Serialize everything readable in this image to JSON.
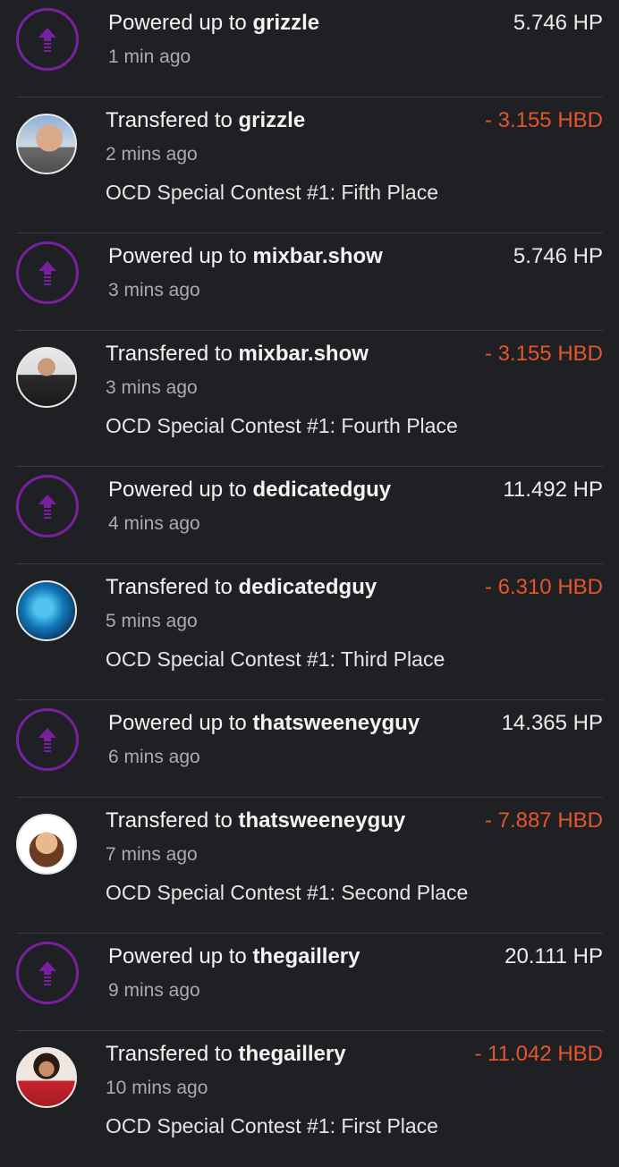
{
  "colors": {
    "background": "#1f2023",
    "power_icon": "#7b1fa2",
    "negative_amount": "#e4552b",
    "secondary_text": "#a9abb0"
  },
  "transactions": [
    {
      "type": "power_up",
      "prefix": "Powered up to ",
      "account": "grizzle",
      "time": "1 min ago",
      "amount": "5.746 HP",
      "icon": "power-up-arrow-icon"
    },
    {
      "type": "transfer",
      "prefix": "Transfered to ",
      "account": "grizzle",
      "time": "2 mins ago",
      "memo": "OCD Special Contest #1: Fifth Place",
      "amount": "- 3.155 HBD"
    },
    {
      "type": "power_up",
      "prefix": "Powered up to ",
      "account": "mixbar.show",
      "time": "3 mins ago",
      "amount": "5.746 HP",
      "icon": "power-up-arrow-icon"
    },
    {
      "type": "transfer",
      "prefix": "Transfered to ",
      "account": "mixbar.show",
      "time": "3 mins ago",
      "memo": "OCD Special Contest #1: Fourth Place",
      "amount": "- 3.155 HBD"
    },
    {
      "type": "power_up",
      "prefix": "Powered up to ",
      "account": "dedicatedguy",
      "time": "4 mins ago",
      "amount": "11.492 HP",
      "icon": "power-up-arrow-icon"
    },
    {
      "type": "transfer",
      "prefix": "Transfered to ",
      "account": "dedicatedguy",
      "time": "5 mins ago",
      "memo": "OCD Special Contest #1: Third Place",
      "amount": "- 6.310 HBD"
    },
    {
      "type": "power_up",
      "prefix": "Powered up to ",
      "account": "thatsweeneyguy",
      "time": "6 mins ago",
      "amount": "14.365 HP",
      "icon": "power-up-arrow-icon"
    },
    {
      "type": "transfer",
      "prefix": "Transfered to ",
      "account": "thatsweeneyguy",
      "time": "7 mins ago",
      "memo": "OCD Special Contest #1: Second Place",
      "amount": "- 7.887 HBD"
    },
    {
      "type": "power_up",
      "prefix": "Powered up to ",
      "account": "thegaillery",
      "time": "9 mins ago",
      "amount": "20.111 HP",
      "icon": "power-up-arrow-icon"
    },
    {
      "type": "transfer",
      "prefix": "Transfered to ",
      "account": "thegaillery",
      "time": "10 mins ago",
      "memo": "OCD Special Contest #1: First Place",
      "amount": "- 11.042 HBD"
    }
  ]
}
